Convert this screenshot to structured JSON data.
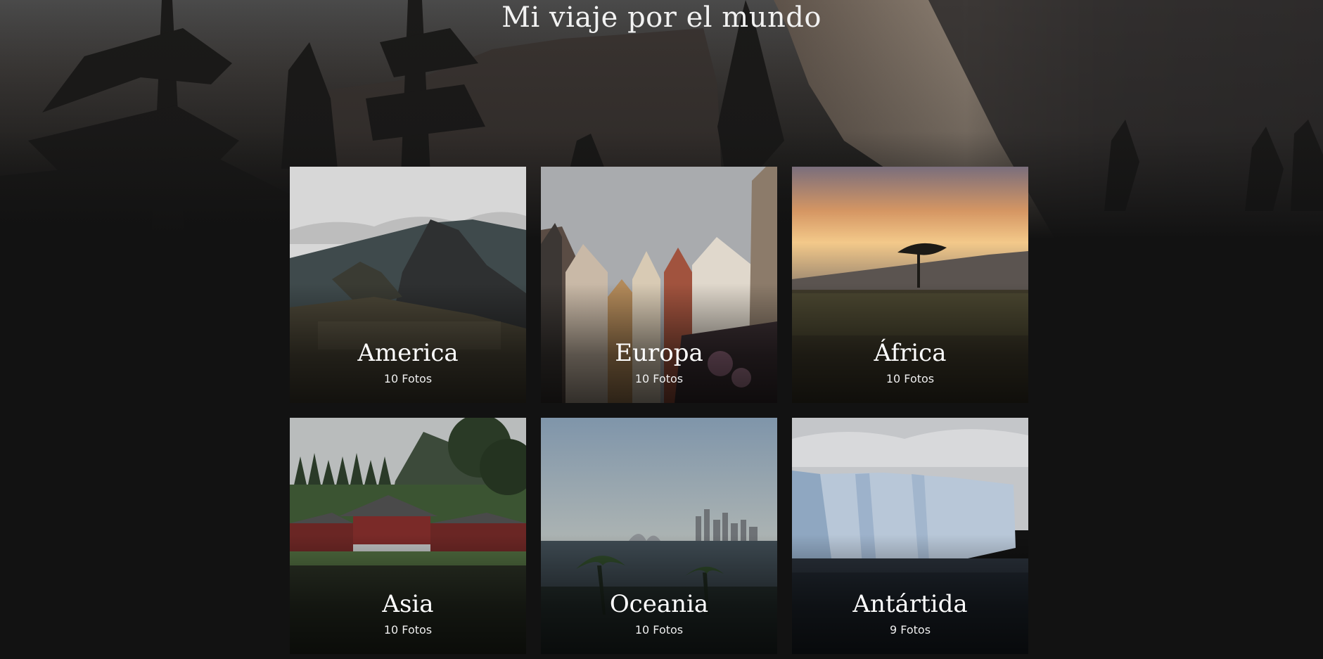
{
  "header": {
    "title": "Mi viaje por el mundo"
  },
  "continents": [
    {
      "name": "America",
      "count": "10 Fotos"
    },
    {
      "name": "Europa",
      "count": "10 Fotos"
    },
    {
      "name": "África",
      "count": "10 Fotos"
    },
    {
      "name": "Asia",
      "count": "10 Fotos"
    },
    {
      "name": "Oceania",
      "count": "10 Fotos"
    },
    {
      "name": "Antártida",
      "count": "9 Fotos"
    }
  ],
  "colors": {
    "background": "#121212",
    "text": "#ffffff"
  }
}
